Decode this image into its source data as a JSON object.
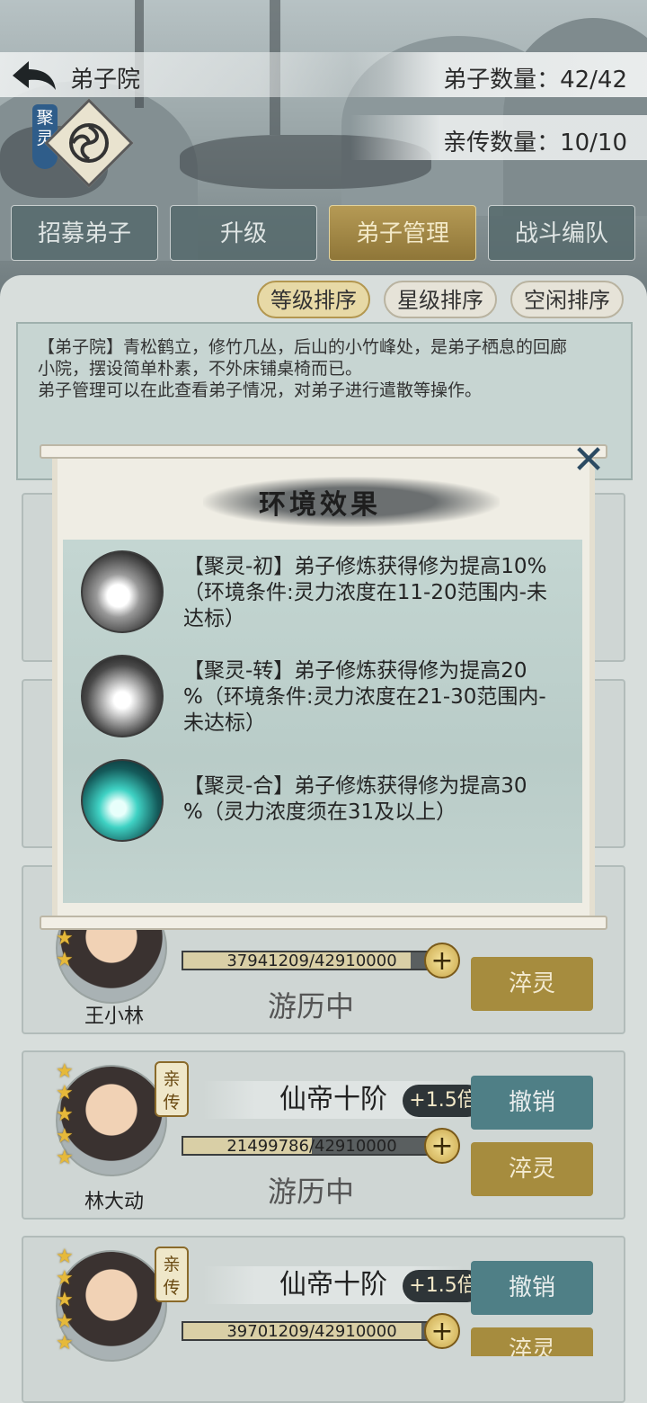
{
  "header": {
    "title": "弟子院",
    "disciple_count_label": "弟子数量：42/42",
    "direct_count_label": "亲传数量：10/10",
    "env_tag": "聚灵"
  },
  "tabs": [
    {
      "label": "招募弟子",
      "active": false
    },
    {
      "label": "升级",
      "active": false
    },
    {
      "label": "弟子管理",
      "active": true
    },
    {
      "label": "战斗编队",
      "active": false
    }
  ],
  "sort_buttons": [
    {
      "label": "等级排序",
      "active": true
    },
    {
      "label": "星级排序",
      "active": false
    },
    {
      "label": "空闲排序",
      "active": false
    }
  ],
  "description": {
    "line1": "【弟子院】青松鹤立，修竹几丛，后山的小竹峰处，是弟子栖息的回廊",
    "line2": "小院，摆设简单朴素，不外床铺桌椅而已。",
    "line3": "弟子管理可以在此查看弟子情况，对弟子进行遣散等操作。"
  },
  "modal": {
    "title": "环境效果",
    "close_icon": "close-icon",
    "effects": [
      {
        "line1": "【聚灵-初】弟子修炼获得修为提高10%",
        "line2": "（环境条件:灵力浓度在11-20范围内-未",
        "line3": "达标）",
        "icon": "swirl-icon"
      },
      {
        "line1": "【聚灵-转】弟子修炼获得修为提高20",
        "line2": "%（环境条件:灵力浓度在21-30范围内-",
        "line3": "未达标）",
        "icon": "burst-icon"
      },
      {
        "line1": "【聚灵-合】弟子修炼获得修为提高30",
        "line2": "%（灵力浓度须在31及以上）",
        "line3": "",
        "icon": "spirit-orb-icon"
      }
    ]
  },
  "disciples": [
    {
      "name": "王小林",
      "rank": "",
      "multiplier": "",
      "exp_text": "37941209/42910000",
      "exp_fraction": 0.884,
      "status": "游历中",
      "btn_top": "",
      "btn_bottom": "淬灵",
      "stars": 2,
      "direct": false
    },
    {
      "name": "林大动",
      "rank": "仙帝十阶",
      "multiplier": "+1.5倍",
      "exp_text": "21499786/42910000",
      "exp_fraction": 0.501,
      "status": "游历中",
      "btn_top": "撤销",
      "btn_bottom": "淬灵",
      "stars": 5,
      "direct": true,
      "direct_label": "亲传"
    },
    {
      "name": "",
      "rank": "仙帝十阶",
      "multiplier": "+1.5倍",
      "exp_text": "39701209/42910000",
      "exp_fraction": 0.925,
      "status": "",
      "btn_top": "撤销",
      "btn_bottom": "淬灵",
      "stars": 5,
      "direct": true,
      "direct_label": "亲传"
    }
  ],
  "colors": {
    "accent_gold": "#a68c3e",
    "teal_button": "#4f7f86",
    "panel_bg": "#d8dedc"
  }
}
